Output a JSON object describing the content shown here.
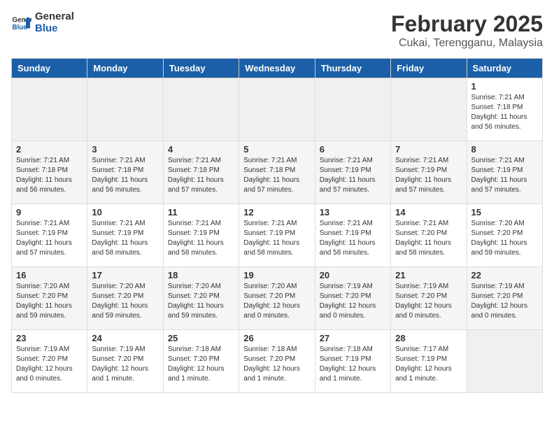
{
  "logo": {
    "general": "General",
    "blue": "Blue"
  },
  "header": {
    "month": "February 2025",
    "location": "Cukai, Terengganu, Malaysia"
  },
  "days_of_week": [
    "Sunday",
    "Monday",
    "Tuesday",
    "Wednesday",
    "Thursday",
    "Friday",
    "Saturday"
  ],
  "weeks": [
    [
      {
        "day": "",
        "info": ""
      },
      {
        "day": "",
        "info": ""
      },
      {
        "day": "",
        "info": ""
      },
      {
        "day": "",
        "info": ""
      },
      {
        "day": "",
        "info": ""
      },
      {
        "day": "",
        "info": ""
      },
      {
        "day": "1",
        "info": "Sunrise: 7:21 AM\nSunset: 7:18 PM\nDaylight: 11 hours\nand 56 minutes."
      }
    ],
    [
      {
        "day": "2",
        "info": "Sunrise: 7:21 AM\nSunset: 7:18 PM\nDaylight: 11 hours\nand 56 minutes."
      },
      {
        "day": "3",
        "info": "Sunrise: 7:21 AM\nSunset: 7:18 PM\nDaylight: 11 hours\nand 56 minutes."
      },
      {
        "day": "4",
        "info": "Sunrise: 7:21 AM\nSunset: 7:18 PM\nDaylight: 11 hours\nand 57 minutes."
      },
      {
        "day": "5",
        "info": "Sunrise: 7:21 AM\nSunset: 7:18 PM\nDaylight: 11 hours\nand 57 minutes."
      },
      {
        "day": "6",
        "info": "Sunrise: 7:21 AM\nSunset: 7:19 PM\nDaylight: 11 hours\nand 57 minutes."
      },
      {
        "day": "7",
        "info": "Sunrise: 7:21 AM\nSunset: 7:19 PM\nDaylight: 11 hours\nand 57 minutes."
      },
      {
        "day": "8",
        "info": "Sunrise: 7:21 AM\nSunset: 7:19 PM\nDaylight: 11 hours\nand 57 minutes."
      }
    ],
    [
      {
        "day": "9",
        "info": "Sunrise: 7:21 AM\nSunset: 7:19 PM\nDaylight: 11 hours\nand 57 minutes."
      },
      {
        "day": "10",
        "info": "Sunrise: 7:21 AM\nSunset: 7:19 PM\nDaylight: 11 hours\nand 58 minutes."
      },
      {
        "day": "11",
        "info": "Sunrise: 7:21 AM\nSunset: 7:19 PM\nDaylight: 11 hours\nand 58 minutes."
      },
      {
        "day": "12",
        "info": "Sunrise: 7:21 AM\nSunset: 7:19 PM\nDaylight: 11 hours\nand 58 minutes."
      },
      {
        "day": "13",
        "info": "Sunrise: 7:21 AM\nSunset: 7:19 PM\nDaylight: 11 hours\nand 58 minutes."
      },
      {
        "day": "14",
        "info": "Sunrise: 7:21 AM\nSunset: 7:20 PM\nDaylight: 11 hours\nand 58 minutes."
      },
      {
        "day": "15",
        "info": "Sunrise: 7:20 AM\nSunset: 7:20 PM\nDaylight: 11 hours\nand 59 minutes."
      }
    ],
    [
      {
        "day": "16",
        "info": "Sunrise: 7:20 AM\nSunset: 7:20 PM\nDaylight: 11 hours\nand 59 minutes."
      },
      {
        "day": "17",
        "info": "Sunrise: 7:20 AM\nSunset: 7:20 PM\nDaylight: 11 hours\nand 59 minutes."
      },
      {
        "day": "18",
        "info": "Sunrise: 7:20 AM\nSunset: 7:20 PM\nDaylight: 11 hours\nand 59 minutes."
      },
      {
        "day": "19",
        "info": "Sunrise: 7:20 AM\nSunset: 7:20 PM\nDaylight: 12 hours\nand 0 minutes."
      },
      {
        "day": "20",
        "info": "Sunrise: 7:19 AM\nSunset: 7:20 PM\nDaylight: 12 hours\nand 0 minutes."
      },
      {
        "day": "21",
        "info": "Sunrise: 7:19 AM\nSunset: 7:20 PM\nDaylight: 12 hours\nand 0 minutes."
      },
      {
        "day": "22",
        "info": "Sunrise: 7:19 AM\nSunset: 7:20 PM\nDaylight: 12 hours\nand 0 minutes."
      }
    ],
    [
      {
        "day": "23",
        "info": "Sunrise: 7:19 AM\nSunset: 7:20 PM\nDaylight: 12 hours\nand 0 minutes."
      },
      {
        "day": "24",
        "info": "Sunrise: 7:19 AM\nSunset: 7:20 PM\nDaylight: 12 hours\nand 1 minute."
      },
      {
        "day": "25",
        "info": "Sunrise: 7:18 AM\nSunset: 7:20 PM\nDaylight: 12 hours\nand 1 minute."
      },
      {
        "day": "26",
        "info": "Sunrise: 7:18 AM\nSunset: 7:20 PM\nDaylight: 12 hours\nand 1 minute."
      },
      {
        "day": "27",
        "info": "Sunrise: 7:18 AM\nSunset: 7:19 PM\nDaylight: 12 hours\nand 1 minute."
      },
      {
        "day": "28",
        "info": "Sunrise: 7:17 AM\nSunset: 7:19 PM\nDaylight: 12 hours\nand 1 minute."
      },
      {
        "day": "",
        "info": ""
      }
    ]
  ]
}
